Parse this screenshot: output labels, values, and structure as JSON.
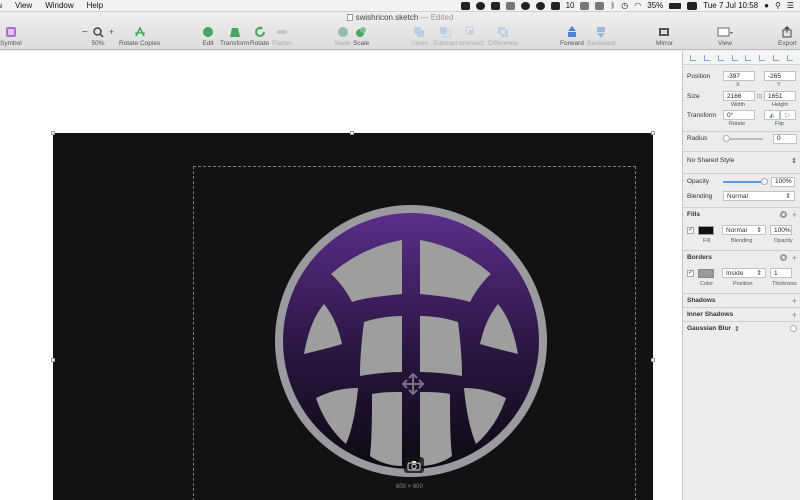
{
  "menubar": {
    "items": [
      "a",
      "View",
      "Window",
      "Help"
    ],
    "status": {
      "battery": "35%",
      "datetime": "Tue 7 Jul  10:58",
      "sync": "10"
    }
  },
  "window": {
    "title": "swishricon.sketch",
    "edited": "— Edited"
  },
  "toolbar": {
    "symbol": "Symbol",
    "zoom": "50%",
    "rotate_copies": "Rotate Copies",
    "edit": "Edit",
    "transform": "Transform",
    "rotate": "Rotate",
    "flatten": "Flatten",
    "mask": "Mask",
    "scale": "Scale",
    "union": "Union",
    "subtract": "Subtract",
    "intersect": "Intersect",
    "difference": "Difference",
    "forward": "Forward",
    "backward": "Backward",
    "mirror": "Mirror",
    "view": "View",
    "export": "Export"
  },
  "canvas": {
    "size_label": "600 × 600",
    "colors": {
      "artboard": "#121212",
      "ring": "#9a9aa0",
      "purple": "#5a2e8a",
      "dark": "#0c0a12",
      "ball": "#9e9e9e"
    }
  },
  "inspector": {
    "position": {
      "label": "Position",
      "x": "-397",
      "y": "-265",
      "x_cap": "X",
      "y_cap": "Y"
    },
    "size": {
      "label": "Size",
      "width": "2166",
      "height": "1651",
      "w_cap": "Width",
      "h_cap": "Height"
    },
    "transform": {
      "label": "Transform",
      "rotate": "0°",
      "rotate_cap": "Rotate",
      "flip_cap": "Flip"
    },
    "radius": {
      "label": "Radius",
      "value": "0"
    },
    "shared_style": "No Shared Style",
    "opacity": {
      "label": "Opacity",
      "value": "100%",
      "level": 1.0
    },
    "blending": {
      "label": "Blending",
      "value": "Normal"
    },
    "fills": {
      "title": "Fills",
      "blend": "Normal",
      "opacity": "100%",
      "cap_fill": "Fill",
      "cap_blend": "Blending",
      "cap_opacity": "Opacity",
      "color": "#111111"
    },
    "borders": {
      "title": "Borders",
      "position": "Inside",
      "thickness": "1",
      "cap_color": "Color",
      "cap_position": "Position",
      "cap_thickness": "Thickness",
      "color": "#9a9a9a"
    },
    "shadows": "Shadows",
    "inner_shadows": "Inner Shadows",
    "gaussian_blur": "Gaussian Blur"
  }
}
